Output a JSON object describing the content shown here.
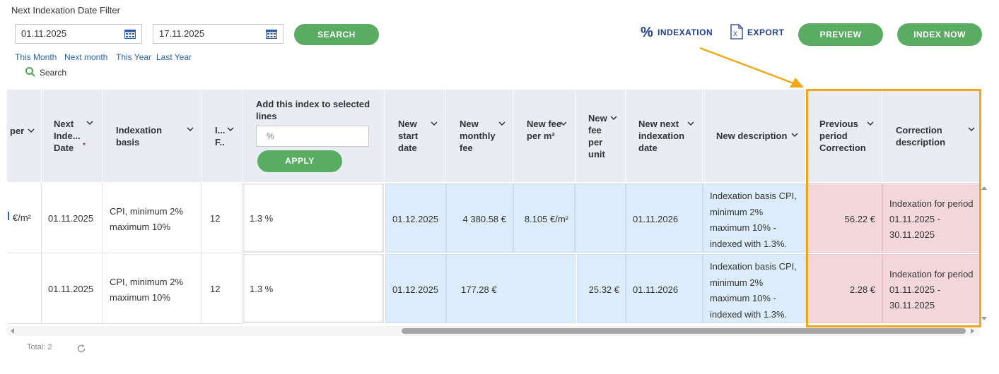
{
  "filter": {
    "title": "Next Indexation Date Filter",
    "date_from": "01.11.2025",
    "date_to": "17.11.2025",
    "search_button": "SEARCH",
    "quick_links": [
      "This Month",
      "Next month",
      "This Year",
      "Last Year"
    ],
    "search_link": "Search"
  },
  "actions": {
    "indexation": "INDEXATION",
    "export": "EXPORT",
    "preview": "PREVIEW",
    "index_now": "INDEX NOW"
  },
  "bulk": {
    "label": "Add this index to selected lines",
    "placeholder": "%",
    "apply": "APPLY"
  },
  "columns": {
    "per": "per",
    "next_index_date": "Next Inde... Date",
    "indexation_basis": "Indexation basis",
    "i_f": "I... F..",
    "new_start_date": "New start date",
    "new_monthly_fee": "New monthly fee",
    "new_fee_per_m2": "New fee per m²",
    "new_fee_per_unit": "New fee per unit",
    "new_next_indexation_date": "New next indexation date",
    "new_description": "New description",
    "previous_period_correction": "Previous period Correction",
    "correction_description": "Correction description"
  },
  "rows": [
    {
      "per": "€/m²",
      "next_index_date": "01.11.2025",
      "indexation_basis": "CPI, minimum 2% maximum 10%",
      "i_f": "12",
      "index": "1.3 %",
      "new_start_date": "01.12.2025",
      "new_monthly_fee": "4 380.58 €",
      "new_fee_per_m2": "8.105 €/m²",
      "new_fee_per_unit": "",
      "new_next_indexation_date": "01.11.2026",
      "new_description": "Indexation basis CPI, minimum 2% maximum 10% - indexed with 1.3%.",
      "previous_period_correction": "56.22 €",
      "correction_description": "Indexation for period 01.11.2025 - 30.11.2025"
    },
    {
      "per": "",
      "next_index_date": "01.11.2025",
      "indexation_basis": "CPI, minimum 2% maximum 10%",
      "i_f": "12",
      "index": "1.3 %",
      "new_start_date": "01.12.2025",
      "new_monthly_fee": "177.28 €",
      "new_fee_per_m2": "",
      "new_fee_per_unit": "25.32 €",
      "new_next_indexation_date": "01.11.2026",
      "new_description": "Indexation basis CPI, minimum 2% maximum 10% - indexed with 1.3%.",
      "previous_period_correction": "2.28 €",
      "correction_description": "Indexation for period 01.11.2025 - 30.11.2025"
    }
  ],
  "footer": {
    "total": "Total: 2"
  },
  "colors": {
    "accent_green": "#5aac63",
    "highlight_orange": "#f0a81a",
    "link_blue": "#2962a8"
  }
}
